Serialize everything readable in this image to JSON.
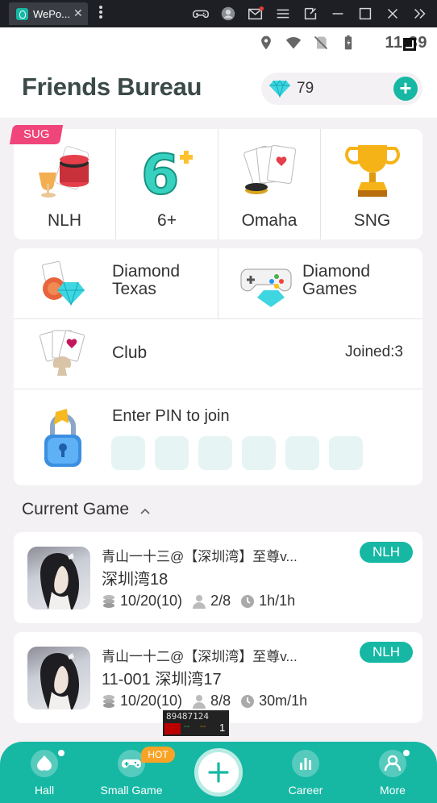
{
  "window": {
    "tab_title": "WePo...",
    "tab_close": "✕",
    "toolbar_icons": [
      "gamepad-icon",
      "account-icon",
      "mail-icon",
      "menu-icon",
      "resize-icon",
      "minimize-icon",
      "maximize-icon",
      "close-icon",
      "sidebar-collapse-icon"
    ]
  },
  "status_bar": {
    "time": "11:39",
    "icons": [
      "location-icon",
      "wifi-icon",
      "no-sim-icon",
      "battery-icon"
    ]
  },
  "header": {
    "title": "Friends Bureau",
    "gems": "79",
    "add_label": "+"
  },
  "game_types": {
    "badge": "SUG",
    "items": [
      {
        "label": "NLH",
        "icon": "poker-chips-icon"
      },
      {
        "label": "6+",
        "icon": "six-plus-icon"
      },
      {
        "label": "Omaha",
        "icon": "cards-icon"
      },
      {
        "label": "SNG",
        "icon": "trophy-icon"
      }
    ]
  },
  "modes": {
    "diamond_texas": "Diamond\nTexas",
    "diamond_games": "Diamond\nGames",
    "club": "Club",
    "club_joined": "Joined:3",
    "pin_label": "Enter PIN to join",
    "pin_slots": 6
  },
  "current_game": {
    "title": "Current Game",
    "games": [
      {
        "owner": "青山一十三@【深圳湾】至尊v...",
        "name": "深圳湾18",
        "blinds": "10/20(10)",
        "players": "2/8",
        "time": "1h/1h",
        "tag": "NLH"
      },
      {
        "owner": "青山一十二@【深圳湾】至尊v...",
        "name": "11-001 深圳湾17",
        "blinds": "10/20(10)",
        "players": "8/8",
        "time": "30m/1h",
        "tag": "NLH"
      }
    ]
  },
  "debug_overlay": {
    "id": "89487124",
    "d1": "--",
    "d2": "--",
    "count": "1"
  },
  "bottom_nav": {
    "hot_badge": "HOT",
    "items": [
      {
        "label": "Hall",
        "icon": "hall-icon"
      },
      {
        "label": "Small Game",
        "icon": "gamepad-icon"
      },
      {
        "label": "Career",
        "icon": "bar-chart-icon"
      },
      {
        "label": "More",
        "icon": "person-icon"
      }
    ]
  },
  "colors": {
    "accent": "#16b8a4",
    "badge_pink": "#f0457a",
    "hot_orange": "#f9a326",
    "background": "#f4f1f4"
  }
}
